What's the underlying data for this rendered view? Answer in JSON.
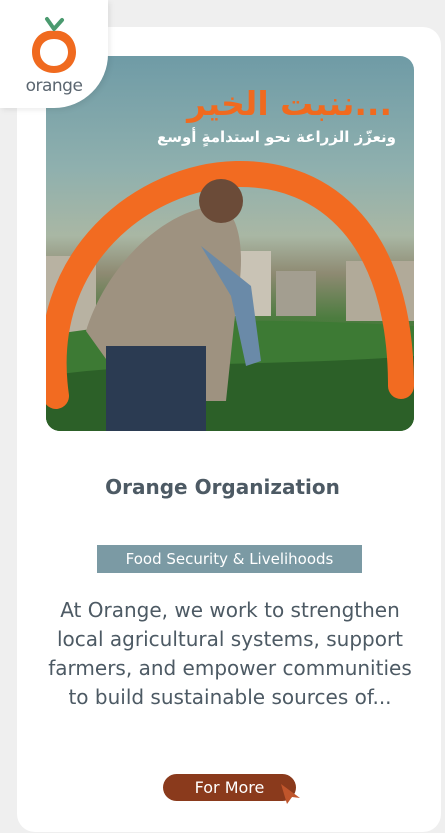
{
  "logo": {
    "brand": "orange"
  },
  "banner": {
    "headline": "ننبت الخير...",
    "subline": "ونعزّز الزراعة نحو استدامةٍ أوسع"
  },
  "card": {
    "title": "Orange Organization",
    "category": "Food Security & Livelihoods",
    "description": "At Orange, we work to strengthen local agricultural systems, support farmers, and empower communities to build sustainable sources of...",
    "button_label": "For More"
  },
  "colors": {
    "brand_orange": "#f06a1f",
    "button": "#8a3a1c",
    "badge": "#7b9aa4",
    "text": "#4d5a64"
  }
}
